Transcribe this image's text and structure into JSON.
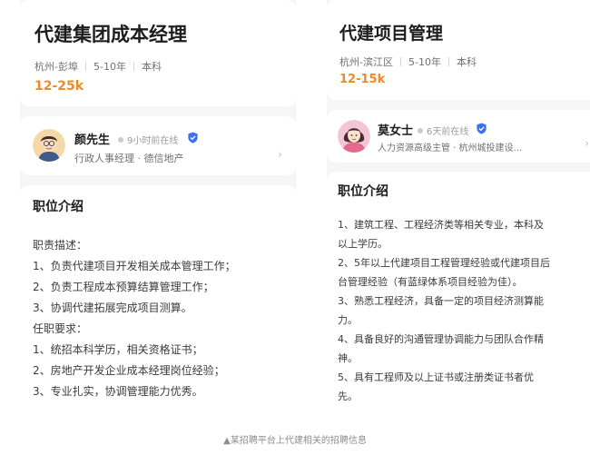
{
  "left": {
    "job_title": "代建集团成本经理",
    "location": "杭州-彭埠",
    "experience": "5-10年",
    "education": "本科",
    "salary": "12-25k",
    "recruiter": {
      "name": "颜先生",
      "online": "9小时前在线",
      "subtitle": "行政人事经理 · 德信地产"
    },
    "section_title": "职位介绍",
    "lines": [
      "职责描述：",
      "1、负责代建项目开发相关成本管理工作；",
      "2、负责工程成本预算结算管理工作；",
      "3、协调代建拓展完成项目测算。",
      "任职要求：",
      "1、统招本科学历，相关资格证书；",
      "2、房地产开发企业成本经理岗位经验；",
      "3、专业扎实，协调管理能力优秀。"
    ]
  },
  "right": {
    "job_title": "代建项目管理",
    "location": "杭州-滨江区",
    "experience": "5-10年",
    "education": "本科",
    "salary": "12-15k",
    "recruiter": {
      "name": "莫女士",
      "online": "6天前在线",
      "subtitle": "人力资源高级主管 · 杭州城投建设..."
    },
    "section_title": "职位介绍",
    "lines": [
      "1、建筑工程、工程经济类等相关专业，本科及",
      "以上学历。",
      "2、5年以上代建项目工程管理经验或代建项目后",
      "台管理经验（有蓝绿体系项目经验为佳）。",
      "3、熟悉工程经济，具备一定的项目经济测算能",
      "力。",
      "4、具备良好的沟通管理协调能力与团队合作精",
      "神。",
      "5、具有工程师及以上证书或注册类证书者优",
      "先。"
    ]
  },
  "caption": "▲某招聘平台上代建相关的招聘信息",
  "colors": {
    "salary": "#f08a24",
    "verified": "#3b6ff5",
    "background": "#f5f6f8"
  },
  "icons": [
    "verified-badge-icon",
    "chevron-right-icon",
    "avatar-male-icon",
    "avatar-female-icon"
  ]
}
